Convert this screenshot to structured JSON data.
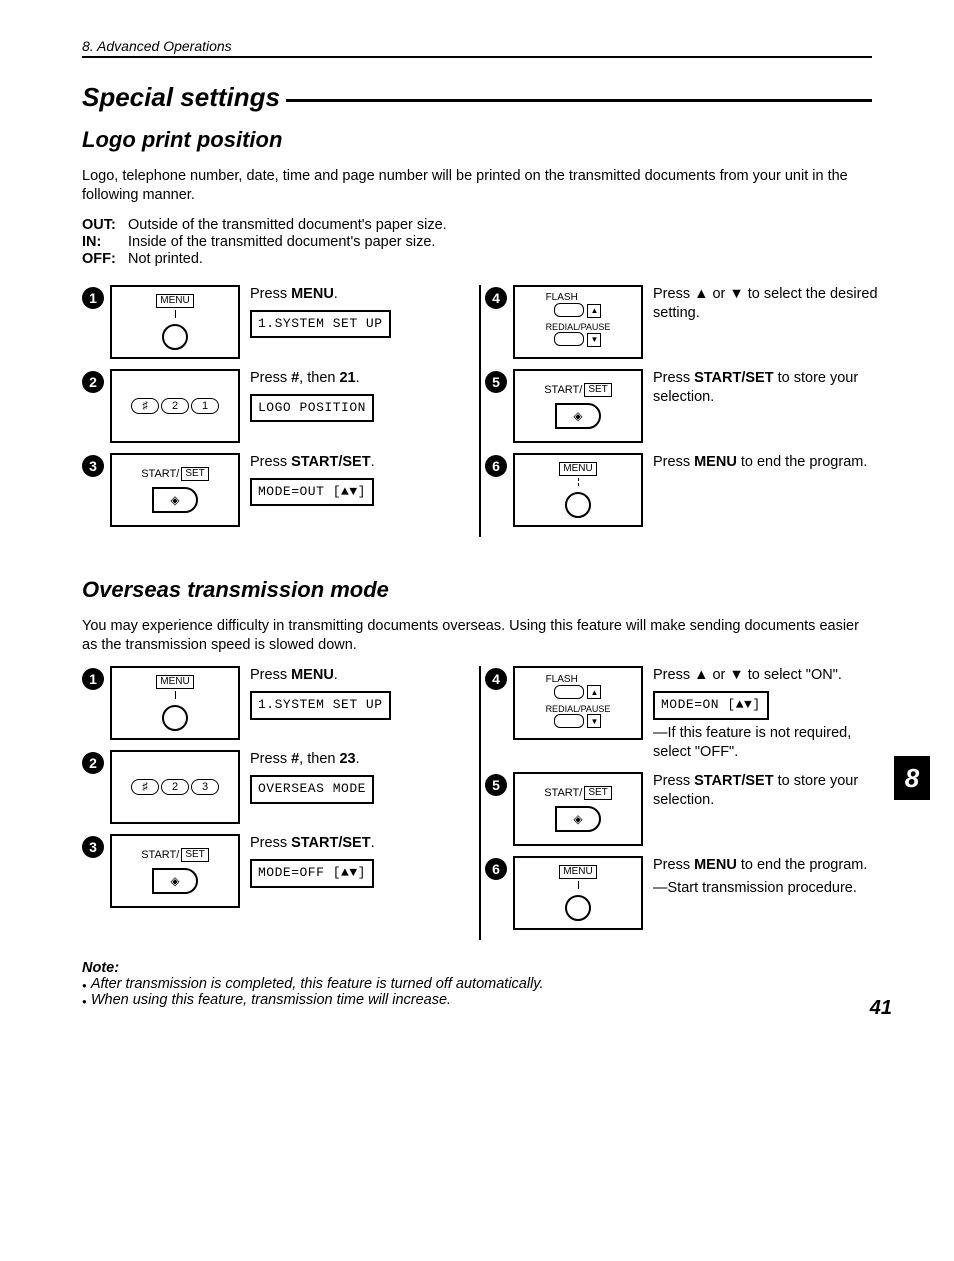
{
  "header": "8.  Advanced Operations",
  "title": "Special settings",
  "section1": {
    "heading": "Logo print position",
    "intro": "Logo, telephone number, date, time and page number will be printed on the transmitted documents from your unit in the following manner.",
    "defs": [
      {
        "k": "OUT:",
        "v": "Outside of the transmitted document's paper size."
      },
      {
        "k": "IN:",
        "v": "Inside of the transmitted document's paper size."
      },
      {
        "k": "OFF:",
        "v": "Not printed."
      }
    ],
    "steps": [
      {
        "n": "1",
        "instr_pre": "Press ",
        "instr_b": "MENU",
        "instr_post": ".",
        "lcd": "1.SYSTEM SET UP",
        "panel": "menu"
      },
      {
        "n": "2",
        "instr_pre": "Press ",
        "instr_b": "#",
        "instr_post": ", then ",
        "instr_b2": "21",
        "instr_post2": ".",
        "lcd": "LOGO POSITION",
        "panel": "keys21"
      },
      {
        "n": "3",
        "instr_pre": "Press ",
        "instr_b": "START/SET",
        "instr_post": ".",
        "lcd": "MODE=OUT   [▲▼]",
        "panel": "startset"
      },
      {
        "n": "4",
        "instr_pre": "Press ▲ or ▼ to select the desired setting.",
        "panel": "flash"
      },
      {
        "n": "5",
        "instr_pre": "Press ",
        "instr_b": "START/SET",
        "instr_post": " to store your selection.",
        "panel": "startset"
      },
      {
        "n": "6",
        "instr_pre": "Press ",
        "instr_b": "MENU",
        "instr_post": " to end the program.",
        "panel": "menu"
      }
    ]
  },
  "section2": {
    "heading": "Overseas transmission mode",
    "intro": "You may experience difficulty in transmitting documents overseas. Using this feature will make sending documents easier as the transmission speed is slowed down.",
    "steps": [
      {
        "n": "1",
        "instr_pre": "Press ",
        "instr_b": "MENU",
        "instr_post": ".",
        "lcd": "1.SYSTEM SET UP",
        "panel": "menu"
      },
      {
        "n": "2",
        "instr_pre": "Press ",
        "instr_b": "#",
        "instr_post": ", then ",
        "instr_b2": "23",
        "instr_post2": ".",
        "lcd": "OVERSEAS MODE",
        "panel": "keys23"
      },
      {
        "n": "3",
        "instr_pre": "Press ",
        "instr_b": "START/SET",
        "instr_post": ".",
        "lcd": "MODE=OFF   [▲▼]",
        "panel": "startset"
      },
      {
        "n": "4",
        "instr_pre": "Press ▲ or ▼ to select \"ON\".",
        "lcd": "MODE=ON    [▲▼]",
        "panel": "flash",
        "sub": "—If this feature is not required, select \"OFF\"."
      },
      {
        "n": "5",
        "instr_pre": "Press ",
        "instr_b": "START/SET",
        "instr_post": " to store your selection.",
        "panel": "startset"
      },
      {
        "n": "6",
        "instr_pre": "Press ",
        "instr_b": "MENU",
        "instr_post": " to end the program.",
        "panel": "menu",
        "sub": "—Start transmission procedure."
      }
    ]
  },
  "note": {
    "title": "Note:",
    "items": [
      "After transmission is completed, this feature is turned off automatically.",
      "When using this feature, transmission time will increase."
    ]
  },
  "panel_labels": {
    "menu": "MENU",
    "flash": "FLASH",
    "redial": "REDIAL/PAUSE",
    "start": "START/",
    "set": "SET",
    "hash": "♯",
    "k2": "2",
    "k1": "1",
    "k3": "3"
  },
  "chapter_tab": "8",
  "page_number": "41"
}
